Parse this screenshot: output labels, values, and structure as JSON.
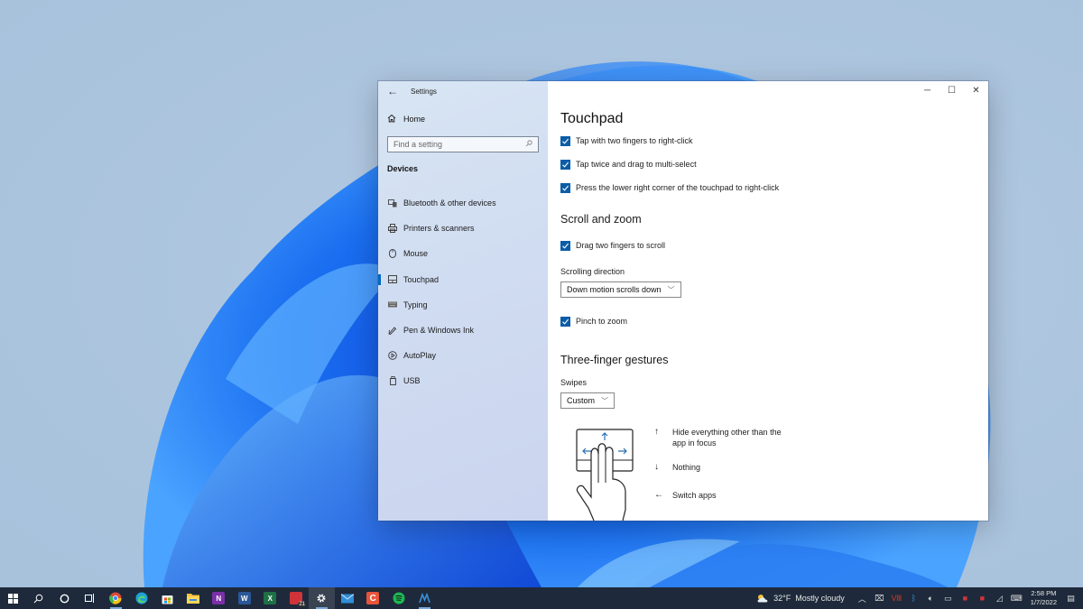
{
  "window": {
    "app_title": "Settings",
    "controls": {
      "minimize": "─",
      "maximize": "☐",
      "close": "✕"
    }
  },
  "sidebar": {
    "back_icon": "←",
    "home_label": "Home",
    "search_placeholder": "Find a setting",
    "section": "Devices",
    "items": [
      {
        "label": "Bluetooth & other devices",
        "icon": "bluetooth-devices-icon",
        "active": false
      },
      {
        "label": "Printers & scanners",
        "icon": "printer-icon",
        "active": false
      },
      {
        "label": "Mouse",
        "icon": "mouse-icon",
        "active": false
      },
      {
        "label": "Touchpad",
        "icon": "touchpad-icon",
        "active": true
      },
      {
        "label": "Typing",
        "icon": "keyboard-icon",
        "active": false
      },
      {
        "label": "Pen & Windows Ink",
        "icon": "pen-icon",
        "active": false
      },
      {
        "label": "AutoPlay",
        "icon": "autoplay-icon",
        "active": false
      },
      {
        "label": "USB",
        "icon": "usb-icon",
        "active": false
      }
    ]
  },
  "main": {
    "title": "Touchpad",
    "tap_options": [
      {
        "label": "Tap with two fingers to right-click",
        "checked": true
      },
      {
        "label": "Tap twice and drag to multi-select",
        "checked": true
      },
      {
        "label": "Press the lower right corner of the touchpad to right-click",
        "checked": true
      }
    ],
    "scroll_zoom": {
      "heading": "Scroll and zoom",
      "drag_scroll": {
        "label": "Drag two fingers to scroll",
        "checked": true
      },
      "direction_label": "Scrolling direction",
      "direction_value": "Down motion scrolls down",
      "pinch": {
        "label": "Pinch to zoom",
        "checked": true
      }
    },
    "three_finger": {
      "heading": "Three-finger gestures",
      "swipes_label": "Swipes",
      "swipes_value": "Custom",
      "gestures": [
        {
          "arrow": "↑",
          "label": "Hide everything other than the app in focus"
        },
        {
          "arrow": "↓",
          "label": "Nothing"
        },
        {
          "arrow": "←",
          "label": "Switch apps"
        }
      ]
    }
  },
  "taskbar": {
    "apps": [
      {
        "name": "start",
        "label": "",
        "color": "#ffffff"
      },
      {
        "name": "search",
        "label": "",
        "color": "#ffffff"
      },
      {
        "name": "cortana",
        "label": "",
        "color": "#ffffff"
      },
      {
        "name": "task-view",
        "label": "",
        "color": "#ffffff"
      },
      {
        "name": "chrome",
        "label": "",
        "color": "#e44134",
        "running": true
      },
      {
        "name": "edge",
        "label": "",
        "color": "#1fa0d8"
      },
      {
        "name": "store",
        "label": "",
        "color": "#f2f2f2"
      },
      {
        "name": "file-explorer",
        "label": "",
        "color": "#f3c23e"
      },
      {
        "name": "onenote",
        "label": "N",
        "color": "#7b2fa8"
      },
      {
        "name": "word",
        "label": "W",
        "color": "#2b5797"
      },
      {
        "name": "excel",
        "label": "X",
        "color": "#1e7145"
      },
      {
        "name": "acrobat",
        "label": "",
        "color": "#d13438",
        "badge": "21"
      },
      {
        "name": "settings",
        "label": "",
        "color": "#ffffff",
        "running": true,
        "active": true
      },
      {
        "name": "mail",
        "label": "",
        "color": "#2f8fd8"
      },
      {
        "name": "castify",
        "label": "",
        "color": "#e7543c"
      },
      {
        "name": "spotify",
        "label": "",
        "color": "#1db954"
      },
      {
        "name": "app-blue",
        "label": "",
        "color": "#3b8fd8",
        "running": true
      }
    ],
    "weather": {
      "temp": "32°F",
      "condition": "Mostly cloudy"
    },
    "time": "2:58 PM",
    "date": "1/7/2022"
  }
}
